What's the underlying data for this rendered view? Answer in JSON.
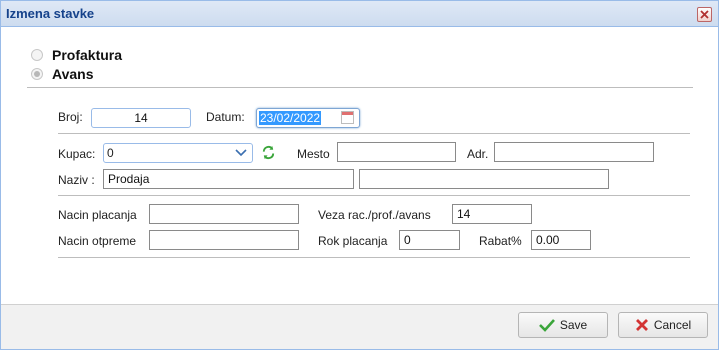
{
  "window": {
    "title": "Izmena stavke"
  },
  "type_options": {
    "profaktura": {
      "label": "Profaktura",
      "checked": false
    },
    "avans": {
      "label": "Avans",
      "checked": true
    }
  },
  "header": {
    "broj_label": "Broj:",
    "broj_value": "14",
    "datum_label": "Datum:",
    "datum_value": "23/02/2022"
  },
  "customer": {
    "kupac_label": "Kupac:",
    "kupac_value": "0",
    "mesto_label": "Mesto",
    "mesto_value": "",
    "adr_label": "Adr.",
    "adr_value": "",
    "naziv_label": "Naziv :",
    "naziv_value": "Prodaja",
    "naziv2_value": ""
  },
  "terms": {
    "nacin_placanja_label": "Nacin placanja",
    "nacin_placanja_value": "",
    "veza_label": "Veza rac./prof./avans",
    "veza_value": "14",
    "nacin_otpreme_label": "Nacin otpreme",
    "nacin_otpreme_value": "",
    "rok_label": "Rok placanja",
    "rok_value": "0",
    "rabat_label": "Rabat%",
    "rabat_value": "0.00"
  },
  "buttons": {
    "save": "Save",
    "cancel": "Cancel"
  },
  "icons": {
    "close": "close-icon",
    "calendar": "calendar-icon",
    "dropdown": "chevron-down-icon",
    "refresh": "refresh-icon",
    "save": "check-icon",
    "cancel": "x-icon"
  },
  "colors": {
    "title_text": "#15428b",
    "selection": "#3399ff",
    "save_check": "#3aa53a",
    "cancel_x": "#d33333"
  }
}
